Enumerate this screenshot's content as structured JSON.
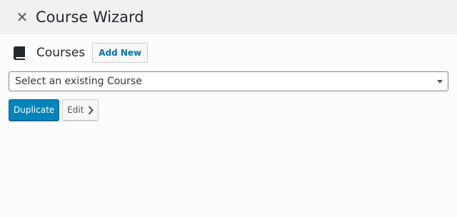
{
  "header": {
    "close_icon": "close-icon",
    "title": "Course Wizard"
  },
  "courses_section": {
    "icon": "book-icon",
    "title": "Courses",
    "add_new_label": "Add New"
  },
  "course_select": {
    "selected_value": "Select an existing Course",
    "icon": "chevron-down-icon"
  },
  "actions": {
    "duplicate_label": "Duplicate",
    "edit_label": "Edit",
    "edit_icon": "chevron-right-icon"
  },
  "colors": {
    "primary": "#0085ba",
    "link": "#0073aa",
    "header_bg": "#f1f1f1"
  }
}
